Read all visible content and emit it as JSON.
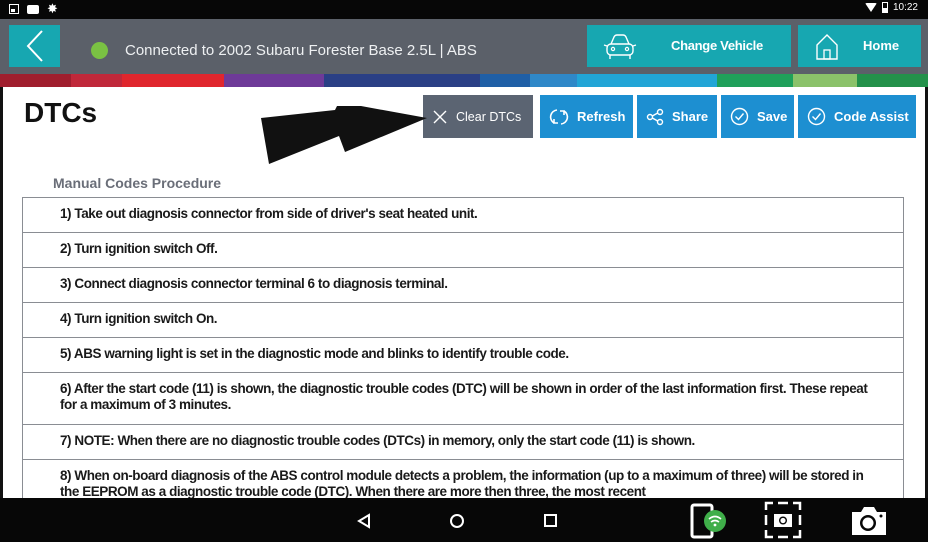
{
  "status_bar": {
    "left_icons": [
      "image-icon",
      "message-icon",
      "settings-icon"
    ],
    "time": "10:22",
    "right_icons": [
      "wifi-icon",
      "battery-icon"
    ]
  },
  "header": {
    "back_icon": "chevron-left-icon",
    "connection_status_color": "#7ac143",
    "connection_text": "Connected to 2002 Subaru Forester Base 2.5L | ABS",
    "change_vehicle_label": "Change Vehicle",
    "home_label": "Home"
  },
  "colors": {
    "header_bg": "#5b6069",
    "header_button": "#17a7b1",
    "action_button": "#1d8fd1",
    "clear_button": "#5b6472",
    "stripe": [
      "#a01e2e",
      "#c0283a",
      "#e0262d",
      "#6e3a98",
      "#4a4a98",
      "#2a3f85",
      "#1f5fa6",
      "#2f88c8",
      "#22a5d6",
      "#1fa05a",
      "#8bc26a",
      "#23914a"
    ]
  },
  "page": {
    "title": "DTCs",
    "actions": {
      "clear": "Clear DTCs",
      "refresh": "Refresh",
      "share": "Share",
      "save": "Save",
      "code_assist": "Code Assist"
    },
    "section_title": "Manual Codes Procedure",
    "procedure_steps": [
      "1) Take out diagnosis connector from side of driver's seat heated unit.",
      "2) Turn ignition switch Off.",
      "3) Connect diagnosis connector terminal 6 to diagnosis terminal.",
      "4) Turn ignition switch On.",
      "5) ABS warning light is set in the diagnostic mode and blinks to identify trouble code.",
      "6) After the start code (11) is shown, the diagnostic trouble codes (DTC) will be shown in order of the last information first. These repeat for a maximum of 3 minutes.",
      "7) NOTE: When there are no diagnostic trouble codes (DTCs) in memory, only the start code (11) is shown.",
      "8) When on-board diagnosis of the ABS control module detects a problem, the information (up to a maximum of three) will be stored in the EEPROM as a diagnostic trouble code (DTC). When there are more then three, the most recent"
    ]
  },
  "nav_bar": {
    "buttons": [
      "back-icon",
      "home-icon",
      "recents-icon",
      "vci-wifi-icon",
      "screenshot-icon",
      "camera-icon"
    ]
  }
}
